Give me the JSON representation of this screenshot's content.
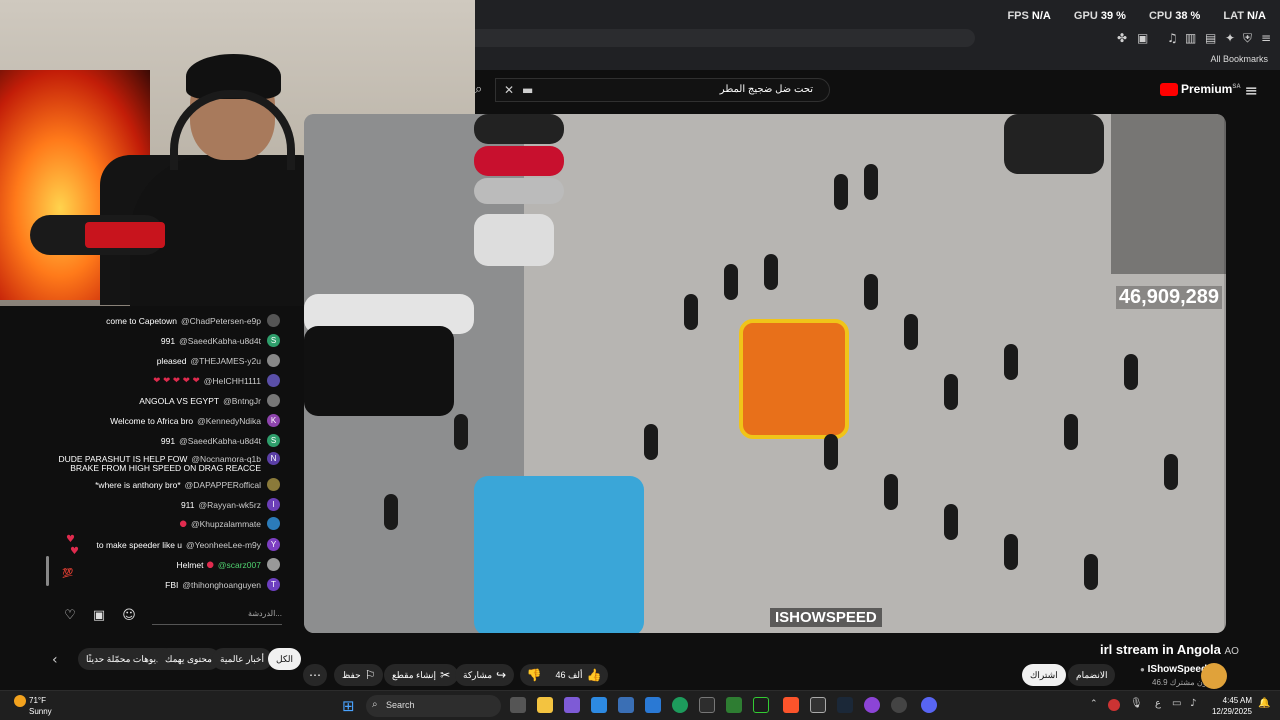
{
  "browser": {
    "stats": {
      "fps_label": "FPS",
      "fps_value": "N/A",
      "gpu_label": "GPU",
      "gpu_value": "39 %",
      "cpu_label": "CPU",
      "cpu_value": "38 %",
      "lat_label": "LAT",
      "lat_value": "N/A"
    },
    "bookmarks_label": "All Bookmarks"
  },
  "youtube": {
    "search_query": "تحت ضل ضجيج المطر",
    "premium_label": "Premium",
    "premium_region": "SA"
  },
  "video": {
    "viewer_count": "46,909,289",
    "watermark": "ISHOWSPEED",
    "title": "irl stream in Angola",
    "title_flag": "AO"
  },
  "chat": {
    "messages": [
      {
        "text": "come to Capetown",
        "author": "@ChadPetersen-e9p",
        "avatar_color": "#555555",
        "initial": ""
      },
      {
        "text": "991",
        "author": "@SaeedKabha-u8d4t",
        "avatar_color": "#2e9e6b",
        "initial": "S"
      },
      {
        "text": "pleased",
        "author": "@THEJAMES-y2u",
        "avatar_color": "#888888",
        "initial": ""
      },
      {
        "text": "❤ ❤ ❤ ❤ ❤",
        "author": "@HeICHH1111",
        "avatar_color": "#5a4fa8",
        "initial": ""
      },
      {
        "text": "ANGOLA VS EGYPT",
        "author": "@BntngJr",
        "avatar_color": "#777777",
        "initial": ""
      },
      {
        "text": "Welcome to Africa bro",
        "author": "@KennedyNdika",
        "avatar_color": "#8e44ad",
        "initial": "K"
      },
      {
        "text": "991",
        "author": "@SaeedKabha-u8d4t",
        "avatar_color": "#2e9e6b",
        "initial": "S"
      },
      {
        "text": "DUDE PARASHUT IS HELP FOW",
        "author": "@Nocnamora-q1b",
        "avatar_color": "#5b3fa6",
        "initial": "N"
      },
      {
        "text": "BRAKE FROM HIGH SPEED ON DRAG REACCE",
        "author": "",
        "avatar_color": "",
        "initial": ""
      },
      {
        "text": "*where is anthony bro*",
        "author": "@DAPAPPERoffical",
        "avatar_color": "#8a7a3a",
        "initial": ""
      },
      {
        "text": "911",
        "author": "@Rayyan-wk5rz",
        "avatar_color": "#6c3fb8",
        "initial": "I"
      },
      {
        "text": "",
        "author": "@Khupzalammate",
        "avatar_color": "#2b7bb9",
        "initial": ""
      },
      {
        "text": "to make speeder like u",
        "author": "@YeonheeLee-m9y",
        "avatar_color": "#7d3fc2",
        "initial": "Y"
      },
      {
        "text": "Helmet",
        "author": "@scarz007",
        "avatar_color": "#999999",
        "initial": ""
      },
      {
        "text": "FBI",
        "author": "@thihonghoanguyen",
        "avatar_color": "#6d3fc0",
        "initial": "T"
      }
    ],
    "input_placeholder": "الدردشة..."
  },
  "actions": {
    "like_count": "46 ألف",
    "share_label": "مشاركة",
    "clip_label": "إنشاء مقطع",
    "save_label": "حفظ",
    "subscribe_label": "اشتراك",
    "join_label": "الانضمام"
  },
  "channel": {
    "name": "IShowSpeed",
    "subscribers": "46.9 مليون مشترك"
  },
  "chips": {
    "all": "الكل",
    "world_news": "أخبار عالمية",
    "for_you": "محتوى يهمك",
    "recent": "فيديوهات محمّلة حديثًا"
  },
  "taskbar": {
    "temperature": "71°F",
    "weather": "Sunny",
    "search_placeholder": "Search",
    "time": "4:45 AM",
    "date": "12/29/2025"
  },
  "colors": {
    "youtube_red": "#ff0000",
    "background": "#0f0f0f",
    "pill": "#272727"
  }
}
